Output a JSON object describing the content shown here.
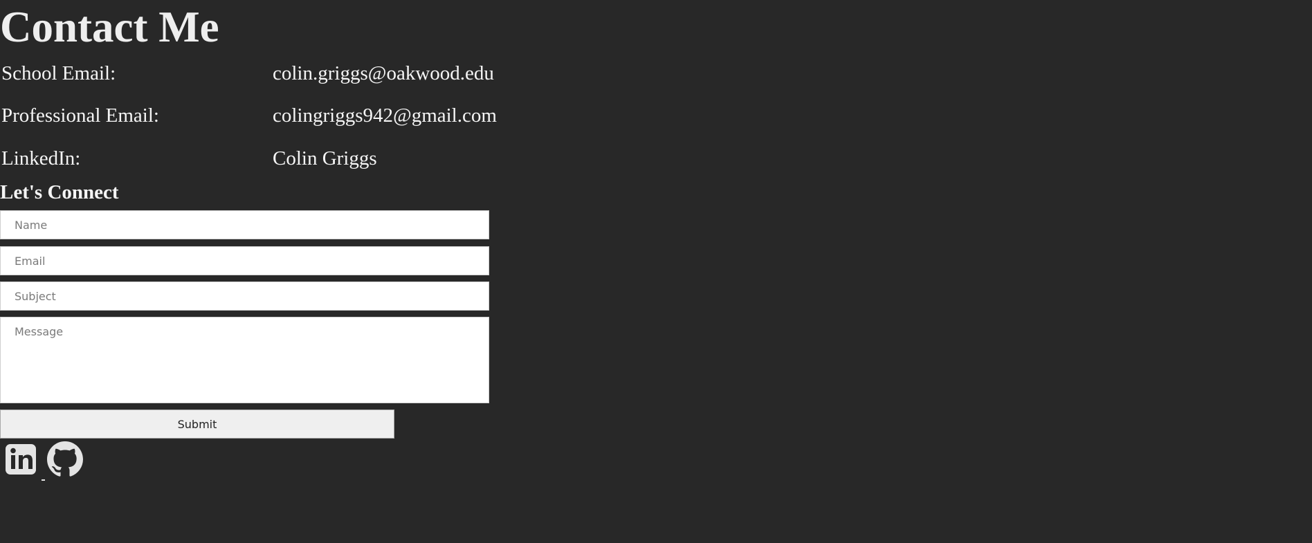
{
  "page": {
    "title": "Contact Me",
    "background_color": "#282828"
  },
  "contact": {
    "rows": [
      {
        "label": "School Email:",
        "value": "colin.griggs@oakwood.edu"
      },
      {
        "label": "Professional Email:",
        "value": "colingriggs942@gmail.com"
      },
      {
        "label": "LinkedIn:",
        "value": "Colin Griggs"
      }
    ]
  },
  "connect": {
    "heading": "Let's Connect",
    "form": {
      "name_placeholder": "Name",
      "email_placeholder": "Email",
      "subject_placeholder": "Subject",
      "message_placeholder": "Message",
      "submit_label": "Submit"
    }
  },
  "social": {
    "icons": [
      {
        "name": "linkedin-icon"
      },
      {
        "name": "github-icon"
      }
    ]
  }
}
